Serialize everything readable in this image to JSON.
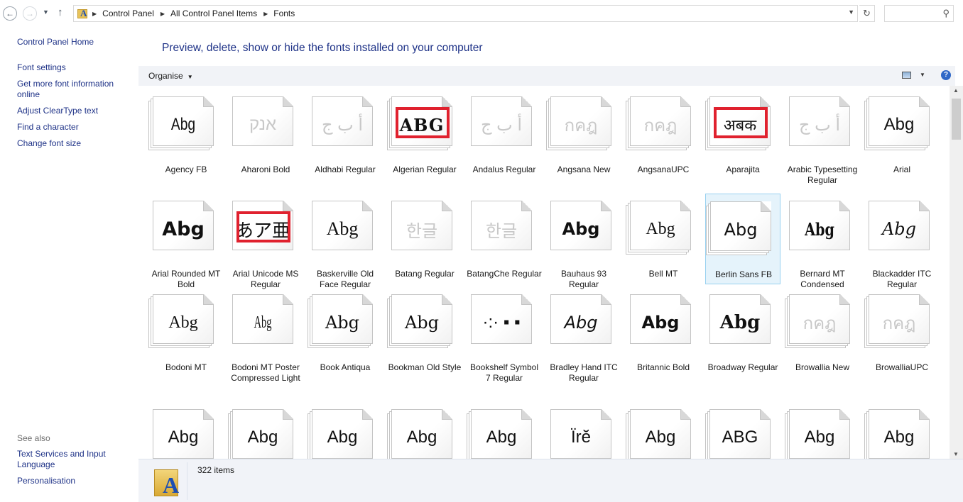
{
  "address_bar": {
    "crumbs": [
      "Control Panel",
      "All Control Panel Items",
      "Fonts"
    ]
  },
  "left_pane": {
    "links": [
      "Control Panel Home",
      "Font settings",
      "Get more font information online",
      "Adjust ClearType text",
      "Find a character",
      "Change font size"
    ],
    "see_also_title": "See also",
    "see_also_links": [
      "Text Services and Input Language",
      "Personalisation"
    ]
  },
  "main": {
    "heading": "Preview, delete, show or hide the fonts installed on your computer",
    "toolbar": {
      "organise_label": "Organise"
    }
  },
  "fonts": [
    {
      "name": "Agency FB",
      "sample": "Abg",
      "stack": true
    },
    {
      "name": "Aharoni Bold",
      "sample": "אנק",
      "dim": true,
      "stack": false
    },
    {
      "name": "Aldhabi Regular",
      "sample": "أ ب ج",
      "dim": true,
      "stack": false
    },
    {
      "name": "Algerian Regular",
      "sample": "ABG",
      "stack": true,
      "highlight": true
    },
    {
      "name": "Andalus Regular",
      "sample": "أ ب ج",
      "dim": true,
      "stack": false
    },
    {
      "name": "Angsana New",
      "sample": "กคฎ",
      "dim": true,
      "stack": true
    },
    {
      "name": "AngsanaUPC",
      "sample": "กคฎ",
      "dim": true,
      "stack": true
    },
    {
      "name": "Aparajita",
      "sample": "अबक",
      "stack": true,
      "highlight": true
    },
    {
      "name": "Arabic Typesetting Regular",
      "sample": "أ ب ج",
      "dim": true,
      "stack": false
    },
    {
      "name": "Arial",
      "sample": "Abg",
      "stack": true
    },
    {
      "name": "Arial Rounded MT Bold",
      "sample": "Abg",
      "stack": false
    },
    {
      "name": "Arial Unicode MS Regular",
      "sample": "あア亜",
      "stack": false,
      "highlight": true
    },
    {
      "name": "Baskerville Old Face Regular",
      "sample": "Abg",
      "stack": false
    },
    {
      "name": "Batang Regular",
      "sample": "한글",
      "dim": true,
      "stack": false
    },
    {
      "name": "BatangChe Regular",
      "sample": "한글",
      "dim": true,
      "stack": false
    },
    {
      "name": "Bauhaus 93 Regular",
      "sample": "Abg",
      "stack": false
    },
    {
      "name": "Bell MT",
      "sample": "Abg",
      "stack": true
    },
    {
      "name": "Berlin Sans FB",
      "sample": "Abg",
      "stack": true,
      "selected": true
    },
    {
      "name": "Bernard MT Condensed",
      "sample": "Abg",
      "stack": false
    },
    {
      "name": "Blackadder ITC Regular",
      "sample": "Abg",
      "stack": false
    },
    {
      "name": "Bodoni MT",
      "sample": "Abg",
      "stack": true
    },
    {
      "name": "Bodoni MT Poster Compressed Light",
      "sample": "Abg",
      "stack": false
    },
    {
      "name": "Book Antiqua",
      "sample": "Abg",
      "stack": true
    },
    {
      "name": "Bookman Old Style",
      "sample": "Abg",
      "stack": true
    },
    {
      "name": "Bookshelf Symbol 7 Regular",
      "sample": "·:· ▪ ▪",
      "stack": false
    },
    {
      "name": "Bradley Hand ITC Regular",
      "sample": "Abg",
      "stack": false
    },
    {
      "name": "Britannic Bold",
      "sample": "Abg",
      "stack": false
    },
    {
      "name": "Broadway Regular",
      "sample": "Abg",
      "stack": false
    },
    {
      "name": "Browallia New",
      "sample": "กคฎ",
      "dim": true,
      "stack": true
    },
    {
      "name": "BrowalliaUPC",
      "sample": "กคฎ",
      "dim": true,
      "stack": true
    },
    {
      "name": "",
      "sample": "Abg",
      "stack": false
    },
    {
      "name": "",
      "sample": "Abg",
      "stack": true
    },
    {
      "name": "",
      "sample": "Abg",
      "stack": true
    },
    {
      "name": "",
      "sample": "Abg",
      "stack": true
    },
    {
      "name": "",
      "sample": "Abg",
      "stack": true
    },
    {
      "name": "",
      "sample": "Ïrĕ",
      "stack": false
    },
    {
      "name": "",
      "sample": "Abg",
      "stack": true
    },
    {
      "name": "",
      "sample": "ABG",
      "stack": true
    },
    {
      "name": "",
      "sample": "Abg",
      "stack": true
    },
    {
      "name": "",
      "sample": "Abg",
      "stack": true
    }
  ],
  "status_bar": {
    "item_count": "322 items"
  },
  "colors": {
    "link": "#1e3287",
    "highlight": "#e0212e",
    "selected_bg": "#e5f3fb"
  },
  "icons": [
    "back-arrow-icon",
    "forward-arrow-icon",
    "up-arrow-icon",
    "refresh-icon",
    "search-icon",
    "help-icon",
    "fonts-folder-icon"
  ]
}
